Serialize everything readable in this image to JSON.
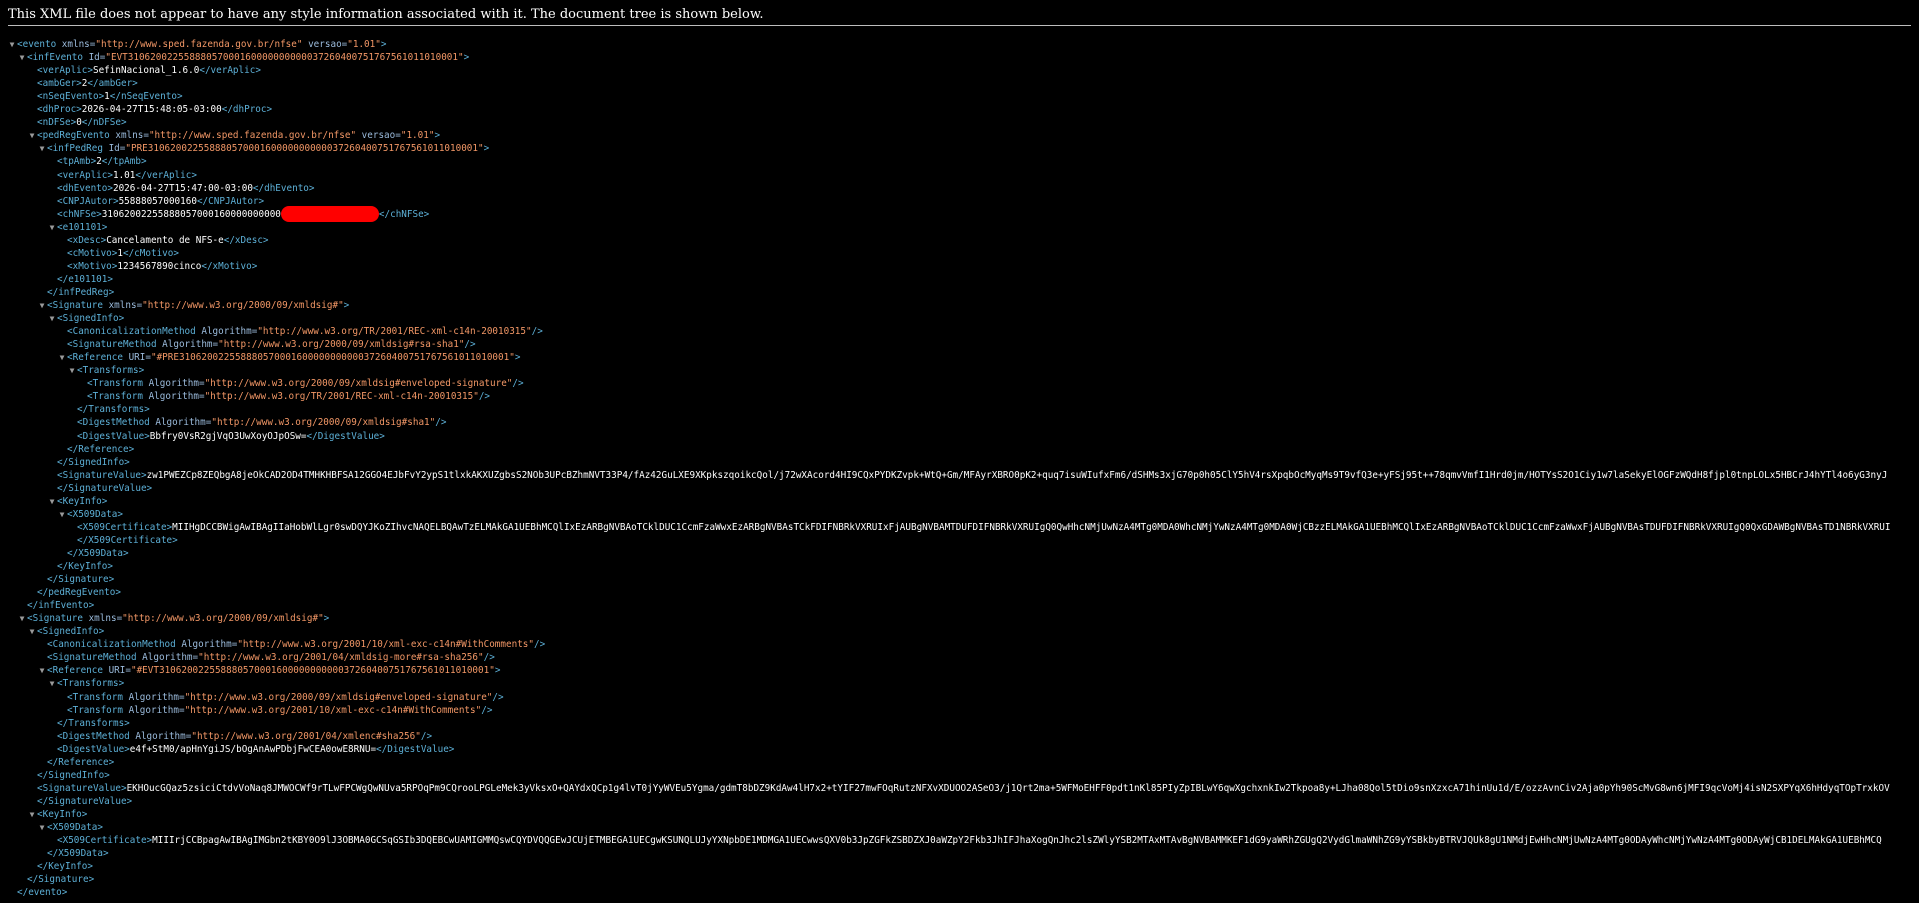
{
  "info_message": "This XML file does not appear to have any style information associated with it. The document tree is shown below.",
  "colors": {
    "background": "#000000",
    "tag": "#5db0d7",
    "attribute_name": "#9bbbdc",
    "attribute_value": "#f29766",
    "text": "#ffffff",
    "redaction": "#ff0000"
  },
  "icons": {
    "toggle": "triangle-down-icon"
  },
  "tree": [
    {
      "indent": 0,
      "toggle": true,
      "parts": [
        [
          "t",
          "<evento"
        ],
        [
          "n",
          " xmlns="
        ],
        [
          "v",
          "\"http://www.sped.fazenda.gov.br/nfse\""
        ],
        [
          "n",
          " versao="
        ],
        [
          "v",
          "\"1.01\""
        ],
        [
          "t",
          ">"
        ]
      ]
    },
    {
      "indent": 1,
      "toggle": true,
      "parts": [
        [
          "t",
          "<infEvento"
        ],
        [
          "n",
          " Id="
        ],
        [
          "v",
          "\"EVT31062002255888057000160000000000037260400751767561011010001\""
        ],
        [
          "t",
          ">"
        ]
      ]
    },
    {
      "indent": 2,
      "toggle": false,
      "parts": [
        [
          "t",
          "<verAplic>"
        ],
        [
          "x",
          "SefinNacional_1.6.0"
        ],
        [
          "t",
          "</verAplic>"
        ]
      ]
    },
    {
      "indent": 2,
      "toggle": false,
      "parts": [
        [
          "t",
          "<ambGer>"
        ],
        [
          "x",
          "2"
        ],
        [
          "t",
          "</ambGer>"
        ]
      ]
    },
    {
      "indent": 2,
      "toggle": false,
      "parts": [
        [
          "t",
          "<nSeqEvento>"
        ],
        [
          "x",
          "1"
        ],
        [
          "t",
          "</nSeqEvento>"
        ]
      ]
    },
    {
      "indent": 2,
      "toggle": false,
      "parts": [
        [
          "t",
          "<dhProc>"
        ],
        [
          "x",
          "2026-04-27T15:48:05-03:00"
        ],
        [
          "t",
          "</dhProc>"
        ]
      ]
    },
    {
      "indent": 2,
      "toggle": false,
      "parts": [
        [
          "t",
          "<nDFSe>"
        ],
        [
          "x",
          "0"
        ],
        [
          "t",
          "</nDFSe>"
        ]
      ]
    },
    {
      "indent": 2,
      "toggle": true,
      "parts": [
        [
          "t",
          "<pedRegEvento"
        ],
        [
          "n",
          " xmlns="
        ],
        [
          "v",
          "\"http://www.sped.fazenda.gov.br/nfse\""
        ],
        [
          "n",
          " versao="
        ],
        [
          "v",
          "\"1.01\""
        ],
        [
          "t",
          ">"
        ]
      ]
    },
    {
      "indent": 3,
      "toggle": true,
      "parts": [
        [
          "t",
          "<infPedReg"
        ],
        [
          "n",
          " Id="
        ],
        [
          "v",
          "\"PRE31062002255888057000160000000000037260400751767561011010001\""
        ],
        [
          "t",
          ">"
        ]
      ]
    },
    {
      "indent": 4,
      "toggle": false,
      "parts": [
        [
          "t",
          "<tpAmb>"
        ],
        [
          "x",
          "2"
        ],
        [
          "t",
          "</tpAmb>"
        ]
      ]
    },
    {
      "indent": 4,
      "toggle": false,
      "parts": [
        [
          "t",
          "<verAplic>"
        ],
        [
          "x",
          "1.01"
        ],
        [
          "t",
          "</verAplic>"
        ]
      ]
    },
    {
      "indent": 4,
      "toggle": false,
      "parts": [
        [
          "t",
          "<dhEvento>"
        ],
        [
          "x",
          "2026-04-27T15:47:00-03:00"
        ],
        [
          "t",
          "</dhEvento>"
        ]
      ]
    },
    {
      "indent": 4,
      "toggle": false,
      "parts": [
        [
          "t",
          "<CNPJAutor>"
        ],
        [
          "x",
          "55888057000160"
        ],
        [
          "t",
          "</CNPJAutor>"
        ]
      ]
    },
    {
      "indent": 4,
      "toggle": false,
      "parts": [
        [
          "t",
          "<chNFSe>"
        ],
        [
          "x",
          "31062002255888057000160000000000"
        ],
        [
          "r",
          ""
        ],
        [
          "t",
          "</chNFSe>"
        ]
      ]
    },
    {
      "indent": 4,
      "toggle": true,
      "parts": [
        [
          "t",
          "<e101101>"
        ]
      ]
    },
    {
      "indent": 5,
      "toggle": false,
      "parts": [
        [
          "t",
          "<xDesc>"
        ],
        [
          "x",
          "Cancelamento de NFS-e"
        ],
        [
          "t",
          "</xDesc>"
        ]
      ]
    },
    {
      "indent": 5,
      "toggle": false,
      "parts": [
        [
          "t",
          "<cMotivo>"
        ],
        [
          "x",
          "1"
        ],
        [
          "t",
          "</cMotivo>"
        ]
      ]
    },
    {
      "indent": 5,
      "toggle": false,
      "parts": [
        [
          "t",
          "<xMotivo>"
        ],
        [
          "x",
          "1234567890cinco"
        ],
        [
          "t",
          "</xMotivo>"
        ]
      ]
    },
    {
      "indent": 4,
      "toggle": false,
      "parts": [
        [
          "t",
          "</e101101>"
        ]
      ]
    },
    {
      "indent": 3,
      "toggle": false,
      "parts": [
        [
          "t",
          "</infPedReg>"
        ]
      ]
    },
    {
      "indent": 3,
      "toggle": true,
      "parts": [
        [
          "t",
          "<Signature"
        ],
        [
          "n",
          " xmlns="
        ],
        [
          "v",
          "\"http://www.w3.org/2000/09/xmldsig#\""
        ],
        [
          "t",
          ">"
        ]
      ]
    },
    {
      "indent": 4,
      "toggle": true,
      "parts": [
        [
          "t",
          "<SignedInfo>"
        ]
      ]
    },
    {
      "indent": 5,
      "toggle": false,
      "parts": [
        [
          "t",
          "<CanonicalizationMethod"
        ],
        [
          "n",
          " Algorithm="
        ],
        [
          "v",
          "\"http://www.w3.org/TR/2001/REC-xml-c14n-20010315\""
        ],
        [
          "t",
          "/>"
        ]
      ]
    },
    {
      "indent": 5,
      "toggle": false,
      "parts": [
        [
          "t",
          "<SignatureMethod"
        ],
        [
          "n",
          " Algorithm="
        ],
        [
          "v",
          "\"http://www.w3.org/2000/09/xmldsig#rsa-sha1\""
        ],
        [
          "t",
          "/>"
        ]
      ]
    },
    {
      "indent": 5,
      "toggle": true,
      "parts": [
        [
          "t",
          "<Reference"
        ],
        [
          "n",
          " URI="
        ],
        [
          "v",
          "\"#PRE31062002255888057000160000000000037260400751767561011010001\""
        ],
        [
          "t",
          ">"
        ]
      ]
    },
    {
      "indent": 6,
      "toggle": true,
      "parts": [
        [
          "t",
          "<Transforms>"
        ]
      ]
    },
    {
      "indent": 7,
      "toggle": false,
      "parts": [
        [
          "t",
          "<Transform"
        ],
        [
          "n",
          " Algorithm="
        ],
        [
          "v",
          "\"http://www.w3.org/2000/09/xmldsig#enveloped-signature\""
        ],
        [
          "t",
          "/>"
        ]
      ]
    },
    {
      "indent": 7,
      "toggle": false,
      "parts": [
        [
          "t",
          "<Transform"
        ],
        [
          "n",
          " Algorithm="
        ],
        [
          "v",
          "\"http://www.w3.org/TR/2001/REC-xml-c14n-20010315\""
        ],
        [
          "t",
          "/>"
        ]
      ]
    },
    {
      "indent": 6,
      "toggle": false,
      "parts": [
        [
          "t",
          "</Transforms>"
        ]
      ]
    },
    {
      "indent": 6,
      "toggle": false,
      "parts": [
        [
          "t",
          "<DigestMethod"
        ],
        [
          "n",
          " Algorithm="
        ],
        [
          "v",
          "\"http://www.w3.org/2000/09/xmldsig#sha1\""
        ],
        [
          "t",
          "/>"
        ]
      ]
    },
    {
      "indent": 6,
      "toggle": false,
      "parts": [
        [
          "t",
          "<DigestValue>"
        ],
        [
          "x",
          "Bbfry0VsR2gjVqO3UwXoyOJpOSw="
        ],
        [
          "t",
          "</DigestValue>"
        ]
      ]
    },
    {
      "indent": 5,
      "toggle": false,
      "parts": [
        [
          "t",
          "</Reference>"
        ]
      ]
    },
    {
      "indent": 4,
      "toggle": false,
      "parts": [
        [
          "t",
          "</SignedInfo>"
        ]
      ]
    },
    {
      "indent": 4,
      "toggle": false,
      "parts": [
        [
          "t",
          "<SignatureValue>"
        ],
        [
          "x",
          "zw1PWEZCp8ZEQbgA8jeOkCAD2OD4TMHKHBFSA12GGO4EJbFvY2ypS1tlxkAKXUZgbsS2NOb3UPcBZhmNVT33P4/fAz42GuLXE9XKpkszqoikcQol/j72wXAcord4HI9CQxPYDKZvpk+WtQ+Gm/MFAyrXBRO0pK2+quq7isuWIufxFm6/dSHMs3xjG70p0h05ClY5hV4rsXpqbOcMyqMs9T9vfQ3e+yFSj95t++78qmvVmfI1Hrd0jm/HOTYsS2O1Ciy1w7laSekyElOGFzWQdH8fjpl0tnpLOLx5HBCrJ4hYTl4o6yG3nyJ"
        ]
      ]
    },
    {
      "indent": 4,
      "toggle": false,
      "parts": [
        [
          "t",
          "</SignatureValue>"
        ]
      ]
    },
    {
      "indent": 4,
      "toggle": true,
      "parts": [
        [
          "t",
          "<KeyInfo>"
        ]
      ]
    },
    {
      "indent": 5,
      "toggle": true,
      "parts": [
        [
          "t",
          "<X509Data>"
        ]
      ]
    },
    {
      "indent": 6,
      "toggle": false,
      "parts": [
        [
          "t",
          "<X509Certificate>"
        ],
        [
          "x",
          "MIIHgDCCBWigAwIBAgIIaHobWlLgr0swDQYJKoZIhvcNAQELBQAwTzELMAkGA1UEBhMCQlIxEzARBgNVBAoTCklDUC1CcmFzaWwxEzARBgNVBAsTCkFDIFNBRkVXRUIxFjAUBgNVBAMTDUFDIFNBRkVXRUIgQ0QwHhcNMjUwNzA4MTg0MDA0WhcNMjYwNzA4MTg0MDA0WjCBzzELMAkGA1UEBhMCQlIxEzARBgNVBAoTCklDUC1CcmFzaWwxFjAUBgNVBAsTDUFDIFNBRkVXRUIgQ0QxGDAWBgNVBAsTD1NBRkVXRUI"
        ]
      ]
    },
    {
      "indent": 6,
      "toggle": false,
      "parts": [
        [
          "t",
          "</X509Certificate>"
        ]
      ]
    },
    {
      "indent": 5,
      "toggle": false,
      "parts": [
        [
          "t",
          "</X509Data>"
        ]
      ]
    },
    {
      "indent": 4,
      "toggle": false,
      "parts": [
        [
          "t",
          "</KeyInfo>"
        ]
      ]
    },
    {
      "indent": 3,
      "toggle": false,
      "parts": [
        [
          "t",
          "</Signature>"
        ]
      ]
    },
    {
      "indent": 2,
      "toggle": false,
      "parts": [
        [
          "t",
          "</pedRegEvento>"
        ]
      ]
    },
    {
      "indent": 1,
      "toggle": false,
      "parts": [
        [
          "t",
          "</infEvento>"
        ]
      ]
    },
    {
      "indent": 1,
      "toggle": true,
      "parts": [
        [
          "t",
          "<Signature"
        ],
        [
          "n",
          " xmlns="
        ],
        [
          "v",
          "\"http://www.w3.org/2000/09/xmldsig#\""
        ],
        [
          "t",
          ">"
        ]
      ]
    },
    {
      "indent": 2,
      "toggle": true,
      "parts": [
        [
          "t",
          "<SignedInfo>"
        ]
      ]
    },
    {
      "indent": 3,
      "toggle": false,
      "parts": [
        [
          "t",
          "<CanonicalizationMethod"
        ],
        [
          "n",
          " Algorithm="
        ],
        [
          "v",
          "\"http://www.w3.org/2001/10/xml-exc-c14n#WithComments\""
        ],
        [
          "t",
          "/>"
        ]
      ]
    },
    {
      "indent": 3,
      "toggle": false,
      "parts": [
        [
          "t",
          "<SignatureMethod"
        ],
        [
          "n",
          " Algorithm="
        ],
        [
          "v",
          "\"http://www.w3.org/2001/04/xmldsig-more#rsa-sha256\""
        ],
        [
          "t",
          "/>"
        ]
      ]
    },
    {
      "indent": 3,
      "toggle": true,
      "parts": [
        [
          "t",
          "<Reference"
        ],
        [
          "n",
          " URI="
        ],
        [
          "v",
          "\"#EVT31062002255888057000160000000000037260400751767561011010001\""
        ],
        [
          "t",
          ">"
        ]
      ]
    },
    {
      "indent": 4,
      "toggle": true,
      "parts": [
        [
          "t",
          "<Transforms>"
        ]
      ]
    },
    {
      "indent": 5,
      "toggle": false,
      "parts": [
        [
          "t",
          "<Transform"
        ],
        [
          "n",
          " Algorithm="
        ],
        [
          "v",
          "\"http://www.w3.org/2000/09/xmldsig#enveloped-signature\""
        ],
        [
          "t",
          "/>"
        ]
      ]
    },
    {
      "indent": 5,
      "toggle": false,
      "parts": [
        [
          "t",
          "<Transform"
        ],
        [
          "n",
          " Algorithm="
        ],
        [
          "v",
          "\"http://www.w3.org/2001/10/xml-exc-c14n#WithComments\""
        ],
        [
          "t",
          "/>"
        ]
      ]
    },
    {
      "indent": 4,
      "toggle": false,
      "parts": [
        [
          "t",
          "</Transforms>"
        ]
      ]
    },
    {
      "indent": 4,
      "toggle": false,
      "parts": [
        [
          "t",
          "<DigestMethod"
        ],
        [
          "n",
          " Algorithm="
        ],
        [
          "v",
          "\"http://www.w3.org/2001/04/xmlenc#sha256\""
        ],
        [
          "t",
          "/>"
        ]
      ]
    },
    {
      "indent": 4,
      "toggle": false,
      "parts": [
        [
          "t",
          "<DigestValue>"
        ],
        [
          "x",
          "e4f+StM0/apHnYgiJS/bOgAnAwPDbjFwCEA0owE8RNU="
        ],
        [
          "t",
          "</DigestValue>"
        ]
      ]
    },
    {
      "indent": 3,
      "toggle": false,
      "parts": [
        [
          "t",
          "</Reference>"
        ]
      ]
    },
    {
      "indent": 2,
      "toggle": false,
      "parts": [
        [
          "t",
          "</SignedInfo>"
        ]
      ]
    },
    {
      "indent": 2,
      "toggle": false,
      "parts": [
        [
          "t",
          "<SignatureValue>"
        ],
        [
          "x",
          "EKHOucGQaz5zsiciCtdvVoNaq8JMWOCWf9rTLwFPCWgQwNUva5RPOqPm9CQrooLPGLeMek3yVksxO+QAYdxQCp1g4lvT0jYyWVEu5Ygma/gdmT8bDZ9KdAw4lH7x2+tYIF27mwFOqRutzNFXvXDUOO2ASeO3/j1Qrt2ma+5WFMoEHFF0pdt1nKl85PIyZpIBLwY6qwXgchxnkIw2Tkpoa8y+LJha08Qol5tDio9snXzxcA71hinUu1d/E/ozzAvnCiv2Aja0pYh90ScMvG8wn6jMFI9qcVoMj4isN2SXPYqX6hHdyqTOpTrxkOV"
        ]
      ]
    },
    {
      "indent": 2,
      "toggle": false,
      "parts": [
        [
          "t",
          "</SignatureValue>"
        ]
      ]
    },
    {
      "indent": 2,
      "toggle": true,
      "parts": [
        [
          "t",
          "<KeyInfo>"
        ]
      ]
    },
    {
      "indent": 3,
      "toggle": true,
      "parts": [
        [
          "t",
          "<X509Data>"
        ]
      ]
    },
    {
      "indent": 4,
      "toggle": false,
      "parts": [
        [
          "t",
          "<X509Certificate>"
        ],
        [
          "x",
          "MIIIrjCCBpagAwIBAgIMGbn2tKBY0O9lJ3OBMA0GCSqGSIb3DQEBCwUAMIGMMQswCQYDVQQGEwJCUjETMBEGA1UECgwKSUNQLUJyYXNpbDE1MDMGA1UECwwsQXV0b3JpZGFkZSBDZXJ0aWZpY2Fkb3JhIFJhaXogQnJhc2lsZWlyYSB2MTAxMTAvBgNVBAMMKEF1dG9yaWRhZGUgQ2VydGlmaWNhZG9yYSBkbyBTRVJQUk8gU1NMdjEwHhcNMjUwNzA4MTg0ODAyWhcNMjYwNzA4MTg0ODAyWjCB1DELMAkGA1UEBhMCQ"
        ]
      ]
    },
    {
      "indent": 3,
      "toggle": false,
      "parts": [
        [
          "t",
          "</X509Data>"
        ]
      ]
    },
    {
      "indent": 2,
      "toggle": false,
      "parts": [
        [
          "t",
          "</KeyInfo>"
        ]
      ]
    },
    {
      "indent": 1,
      "toggle": false,
      "parts": [
        [
          "t",
          "</Signature>"
        ]
      ]
    },
    {
      "indent": 0,
      "toggle": false,
      "parts": [
        [
          "t",
          "</evento>"
        ]
      ]
    }
  ]
}
